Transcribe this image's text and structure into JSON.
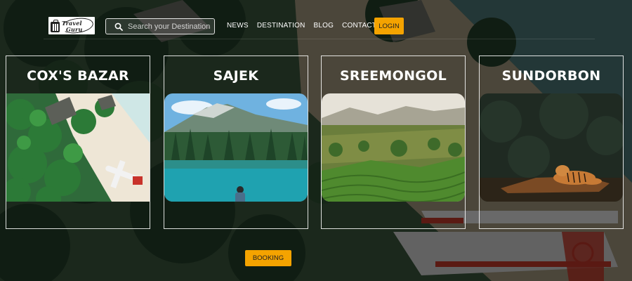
{
  "header": {
    "logo": {
      "line1": "Travel",
      "line2": "Guru"
    },
    "search": {
      "placeholder": "Search your Destination",
      "icon": "search-icon"
    },
    "nav": [
      {
        "label": "NEWS"
      },
      {
        "label": "DESTINATION"
      },
      {
        "label": "BLOG"
      },
      {
        "label": "CONTACT"
      }
    ],
    "login_label": "LOGIN"
  },
  "destinations": [
    {
      "title": "COX'S BAZAR",
      "image": "beach-seaplane-aerial"
    },
    {
      "title": "SAJEK",
      "image": "mountain-lake"
    },
    {
      "title": "SREEMONGOL",
      "image": "tea-garden-hills"
    },
    {
      "title": "SUNDORBON",
      "image": "tiger-in-forest"
    }
  ],
  "booking_label": "BOOKING",
  "colors": {
    "accent": "#f4a300",
    "card_border": "#ffffff",
    "overlay": "rgba(0,0,0,0.55)"
  }
}
